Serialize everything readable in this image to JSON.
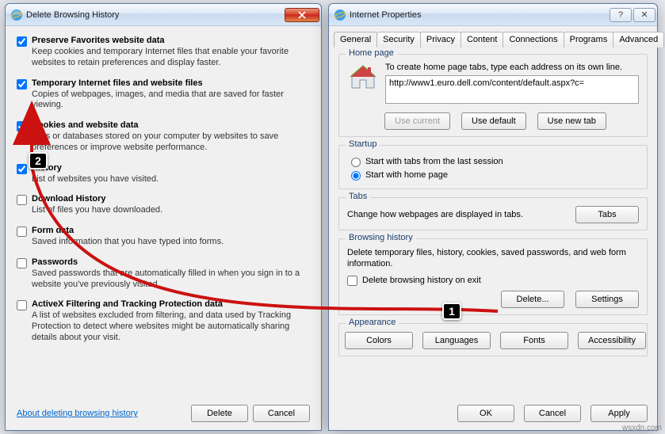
{
  "dbh": {
    "title": "Delete Browsing History",
    "opts": [
      {
        "checked": true,
        "label": "Preserve Favorites website data",
        "desc": "Keep cookies and temporary Internet files that enable your favorite websites to retain preferences and display faster."
      },
      {
        "checked": true,
        "label": "Temporary Internet files and website files",
        "desc": "Copies of webpages, images, and media that are saved for faster viewing."
      },
      {
        "checked": true,
        "label": "Cookies and website data",
        "desc": "Files or databases stored on your computer by websites to save preferences or improve website performance."
      },
      {
        "checked": true,
        "label": "History",
        "desc": "List of websites you have visited."
      },
      {
        "checked": false,
        "label": "Download History",
        "desc": "List of files you have downloaded."
      },
      {
        "checked": false,
        "label": "Form data",
        "desc": "Saved information that you have typed into forms."
      },
      {
        "checked": false,
        "label": "Passwords",
        "desc": "Saved passwords that are automatically filled in when you sign in to a website you've previously visited."
      },
      {
        "checked": false,
        "label": "ActiveX Filtering and Tracking Protection data",
        "desc": "A list of websites excluded from filtering, and data used by Tracking Protection to detect where websites might be automatically sharing details about your visit."
      }
    ],
    "about_link": "About deleting browsing history",
    "delete": "Delete",
    "cancel": "Cancel"
  },
  "ip": {
    "title": "Internet Properties",
    "tabs": [
      "General",
      "Security",
      "Privacy",
      "Content",
      "Connections",
      "Programs",
      "Advanced"
    ],
    "home": {
      "group": "Home page",
      "note": "To create home page tabs, type each address on its own line.",
      "url": "http://www1.euro.dell.com/content/default.aspx?c=",
      "use_current": "Use current",
      "use_default": "Use default",
      "use_new_tab": "Use new tab"
    },
    "startup": {
      "group": "Startup",
      "r1": "Start with tabs from the last session",
      "r2": "Start with home page"
    },
    "tabsg": {
      "group": "Tabs",
      "note": "Change how webpages are displayed in tabs.",
      "btn": "Tabs"
    },
    "hist": {
      "group": "Browsing history",
      "note": "Delete temporary files, history, cookies, saved passwords, and web form information.",
      "chk": "Delete browsing history on exit",
      "delete": "Delete...",
      "settings": "Settings"
    },
    "appear": {
      "group": "Appearance",
      "colors": "Colors",
      "langs": "Languages",
      "fonts": "Fonts",
      "access": "Accessibility"
    },
    "ok": "OK",
    "cancel": "Cancel",
    "apply": "Apply"
  },
  "steps": {
    "s1": "1",
    "s2": "2"
  },
  "watermark": "wsxdn.com"
}
